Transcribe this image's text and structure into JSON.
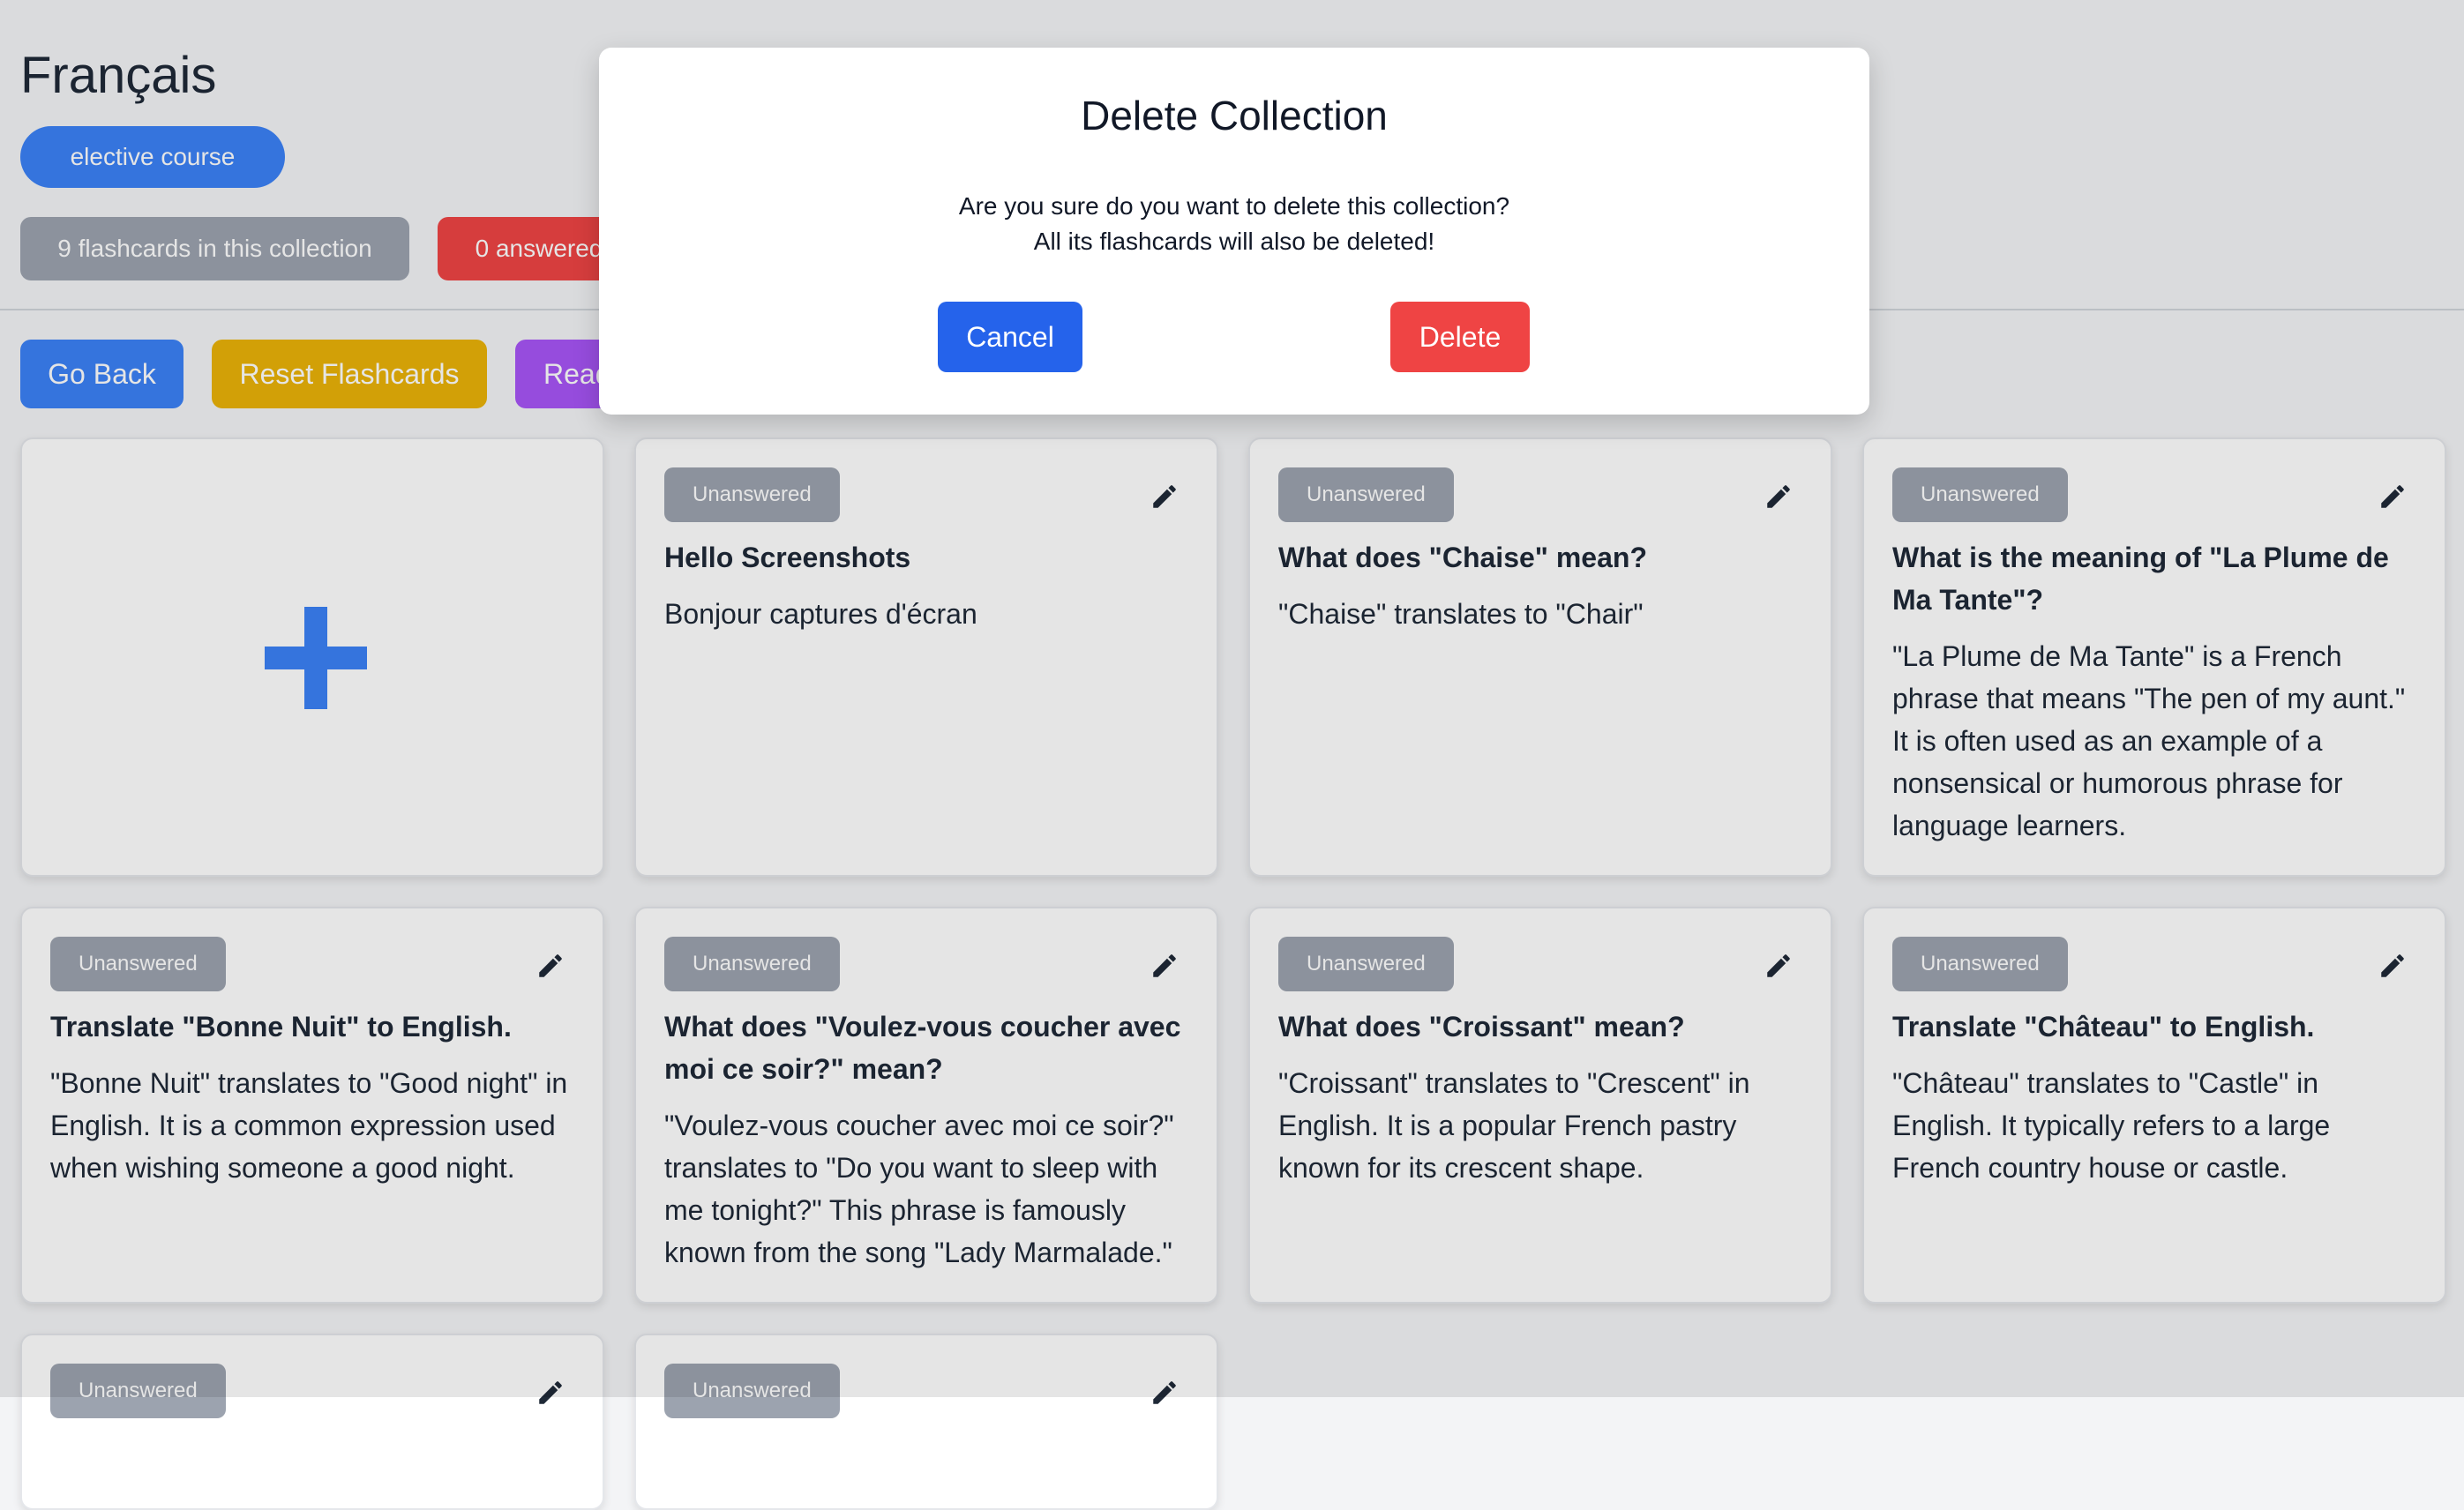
{
  "page": {
    "title": "Français",
    "tag": "elective course",
    "flashcard_count": "9 flashcards in this collection",
    "answered": "0 answered",
    "buttons": {
      "go_back": "Go Back",
      "reset": "Reset Flashcards",
      "read": "Read"
    }
  },
  "cards": [
    {
      "status": "Unanswered",
      "question": "Hello Screenshots",
      "answer": "Bonjour captures d'écran"
    },
    {
      "status": "Unanswered",
      "question": "What does \"Chaise\" mean?",
      "answer": "\"Chaise\" translates to \"Chair\""
    },
    {
      "status": "Unanswered",
      "question": "What is the meaning of \"La Plume de Ma Tante\"?",
      "answer": "\"La Plume de Ma Tante\" is a French phrase that means \"The pen of my aunt.\" It is often used as an example of a nonsensical or humorous phrase for language learners."
    },
    {
      "status": "Unanswered",
      "question": "Translate \"Bonne Nuit\" to English.",
      "answer": "\"Bonne Nuit\" translates to \"Good night\" in English. It is a common expression used when wishing someone a good night."
    },
    {
      "status": "Unanswered",
      "question": "What does \"Voulez-vous coucher avec moi ce soir?\" mean?",
      "answer": "\"Voulez-vous coucher avec moi ce soir?\" translates to \"Do you want to sleep with me tonight?\" This phrase is famously known from the song \"Lady Marmalade.\""
    },
    {
      "status": "Unanswered",
      "question": "What does \"Croissant\" mean?",
      "answer": "\"Croissant\" translates to \"Crescent\" in English. It is a popular French pastry known for its crescent shape."
    },
    {
      "status": "Unanswered",
      "question": "Translate \"Château\" to English.",
      "answer": "\"Château\" translates to \"Castle\" in English. It typically refers to a large French country house or castle."
    },
    {
      "status": "Unanswered",
      "question": "",
      "answer": ""
    },
    {
      "status": "Unanswered",
      "question": "",
      "answer": ""
    }
  ],
  "modal": {
    "title": "Delete Collection",
    "line1": "Are you sure do you want to delete this collection?",
    "line2": "All its flashcards will also be deleted!",
    "cancel": "Cancel",
    "delete": "Delete"
  },
  "colors": {
    "primary": "#3b82f6",
    "warning": "#eab308",
    "purple": "#a855f7",
    "danger": "#ef4444",
    "gray": "#9ca3af"
  }
}
